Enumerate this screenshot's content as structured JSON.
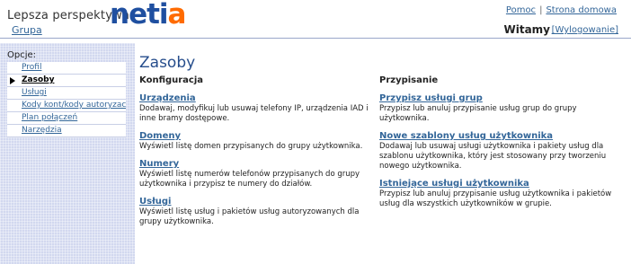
{
  "header": {
    "tagline": "Lepsza perspektywa",
    "logo_main": "neti",
    "logo_dot": "a",
    "links": [
      "Pomoc",
      "Strona domowa"
    ],
    "group_link": "Grupa",
    "welcome": "Witamy",
    "logout": "[Wylogowanie]"
  },
  "sidebar": {
    "heading": "Opcje:",
    "items": [
      {
        "label": "Profil",
        "active": false
      },
      {
        "label": "Zasoby",
        "active": true
      },
      {
        "label": "Usługi",
        "active": false
      },
      {
        "label": "Kody kont/kody autoryzacyjne",
        "active": false
      },
      {
        "label": "Plan połączeń",
        "active": false
      },
      {
        "label": "Narzędzia",
        "active": false
      }
    ]
  },
  "main": {
    "title": "Zasoby",
    "left": {
      "heading": "Konfiguracja",
      "sections": [
        {
          "link": "Urządzenia",
          "desc": "Dodawaj, modyfikuj lub usuwaj telefony IP, urządzenia IAD i inne bramy dostępowe."
        },
        {
          "link": "Domeny",
          "desc": "Wyświetl listę domen przypisanych do grupy użytkownika."
        },
        {
          "link": "Numery",
          "desc": "Wyświetl listę numerów telefonów przypisanych do grupy użytkownika i przypisz te numery do działów."
        },
        {
          "link": "Usługi",
          "desc": "Wyświetl listę usług i pakietów usług autoryzowanych dla grupy użytkownika."
        }
      ]
    },
    "right": {
      "heading": "Przypisanie",
      "sections": [
        {
          "link": "Przypisz usługi grup",
          "desc": "Przypisz lub anuluj przypisanie usług grup do grupy użytkownika."
        },
        {
          "link": "Nowe szablony usług użytkownika",
          "desc": "Dodawaj lub usuwaj usługi użytkownika i pakiety usług dla szablonu użytkownika, który jest stosowany przy tworzeniu nowego użytkownika."
        },
        {
          "link": "Istniejące usługi użytkownika",
          "desc": "Przypisz lub anuluj przypisanie usług użytkownika i pakietów usług dla wszystkich użytkowników w grupie."
        }
      ]
    }
  },
  "colors": {
    "link": "#336699",
    "title": "#264d8c",
    "sidebar_bg": "#d2d8ef",
    "logo_blue": "#1f4fa0",
    "logo_orange": "#ff6b00"
  }
}
